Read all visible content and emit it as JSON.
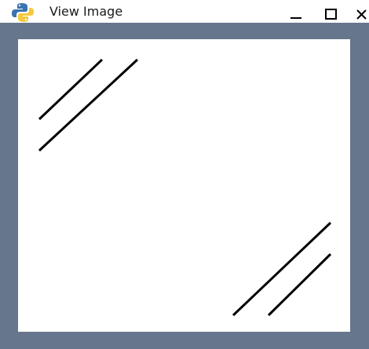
{
  "window": {
    "title": "View Image",
    "icon": "python-logo-icon",
    "frame_color": "#66768c",
    "canvas_color": "#ffffff",
    "line_color": "#000000"
  },
  "titlebar_buttons": [
    {
      "name": "minimize",
      "icon": "minimize-icon"
    },
    {
      "name": "maximize",
      "icon": "maximize-icon"
    },
    {
      "name": "close",
      "icon": "close-icon"
    }
  ]
}
